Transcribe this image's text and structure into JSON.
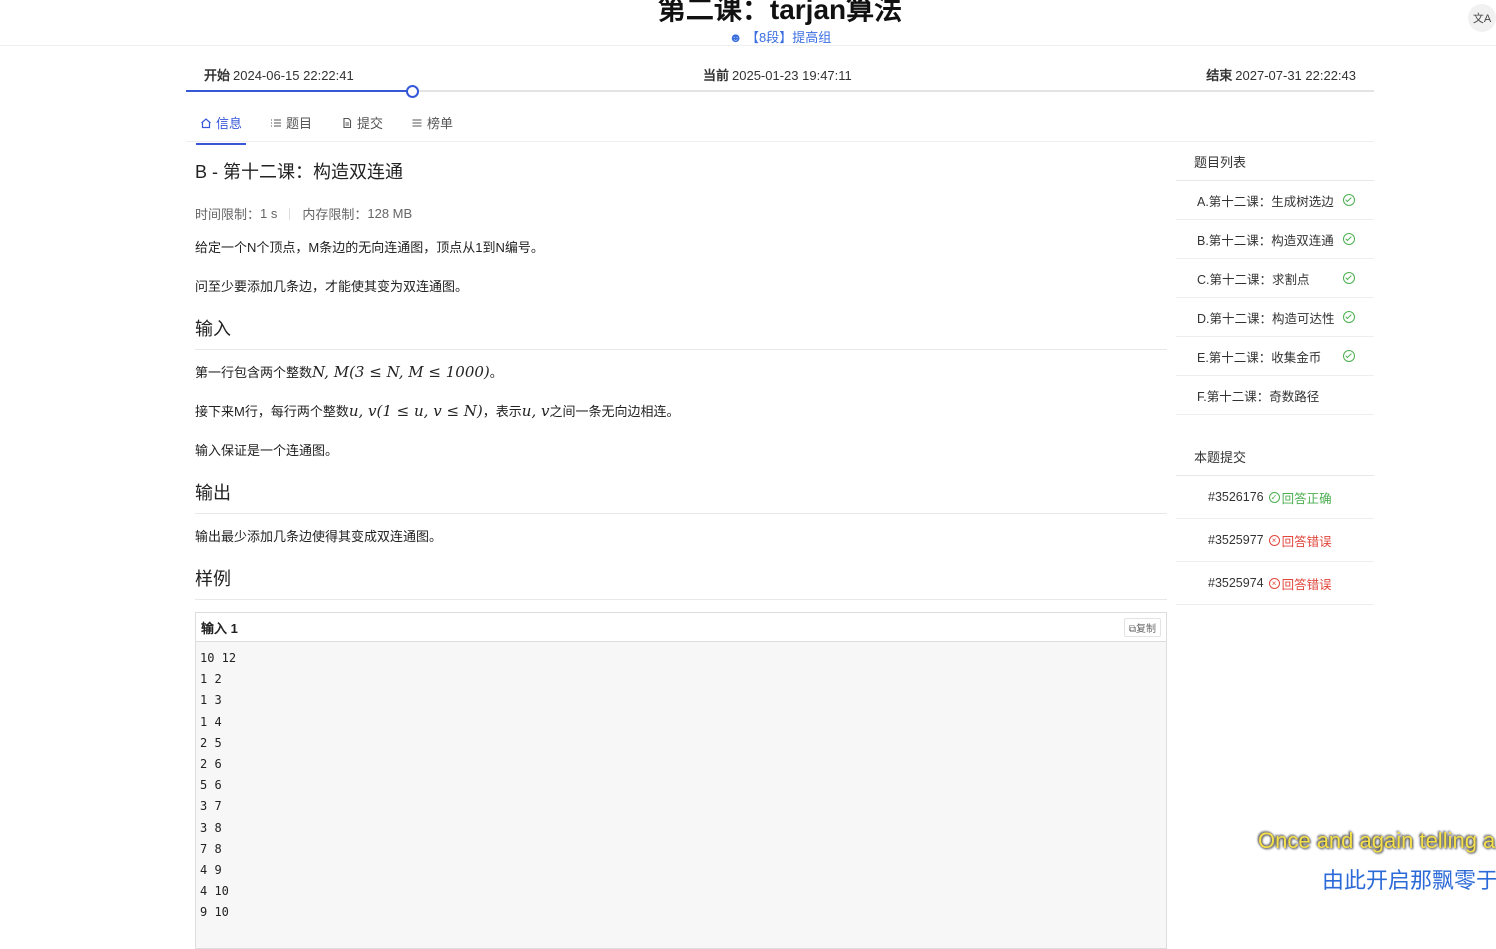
{
  "header": {
    "title": "第二课：tarjan算法",
    "group": "【8段】提高组",
    "translate_icon": "translate-icon"
  },
  "timeline": {
    "start_label": "开始",
    "start_time": "2024-06-15 22:22:41",
    "current_label": "当前",
    "current_time": "2025-01-23 19:47:11",
    "end_label": "结束",
    "end_time": "2027-07-31 22:22:43",
    "progress_fraction": 0.19
  },
  "tabs": [
    {
      "label": "信息",
      "icon": "home-icon",
      "active": true
    },
    {
      "label": "题目",
      "icon": "list-ordered-icon",
      "active": false
    },
    {
      "label": "提交",
      "icon": "file-icon",
      "active": false
    },
    {
      "label": "榜单",
      "icon": "list-icon",
      "active": false
    }
  ],
  "problem": {
    "title": "B - 第十二课：构造双连通",
    "time_limit_label": "时间限制：",
    "time_limit": "1 s",
    "memory_limit_label": "内存限制：",
    "memory_limit": "128 MB",
    "desc1": "给定一个N个顶点，M条边的无向连通图，顶点从1到N编号。",
    "desc2": "问至少要添加几条边，才能使其变为双连通图。",
    "input_heading": "输入",
    "input1_pre": "第一行包含两个整数",
    "input1_math": "N, M(3 ≤ N, M ≤ 1000)",
    "input1_post": "。",
    "input2_pre": "接下来M行，每行两个整数",
    "input2_math": "u, v(1 ≤ u, v ≤ N)",
    "input2_mid": "，表示",
    "input2_math2": "u, v",
    "input2_post": "之间一条无向边相连。",
    "input3": "输入保证是一个连通图。",
    "output_heading": "输出",
    "output1": "输出最少添加几条边使得其变成双连通图。",
    "sample_heading": "样例",
    "sample_title": "输入 1",
    "copy_label": "复制",
    "sample_lines": [
      "10 12",
      "1 2",
      "1 3",
      "1 4",
      "2 5",
      "2 6",
      "5 6",
      "3 7",
      "3 8",
      "7 8",
      "4 9",
      "4 10",
      "9 10"
    ]
  },
  "sidebar": {
    "list_heading": "题目列表",
    "problems": [
      {
        "label": "A.第十二课：生成树选边",
        "solved": true
      },
      {
        "label": "B.第十二课：构造双连通",
        "solved": true
      },
      {
        "label": "C.第十二课：求割点",
        "solved": true
      },
      {
        "label": "D.第十二课：构造可达性",
        "solved": true
      },
      {
        "label": "E.第十二课：收集金币",
        "solved": true
      },
      {
        "label": "F.第十二课：奇数路径",
        "solved": false
      }
    ],
    "submissions_heading": "本题提交",
    "submissions": [
      {
        "id": "#3526176",
        "status": "回答正确",
        "ok": true
      },
      {
        "id": "#3525977",
        "status": "回答错误",
        "ok": false
      },
      {
        "id": "#3525974",
        "status": "回答错误",
        "ok": false
      }
    ]
  },
  "overlay": {
    "line1": "Once and again telling a",
    "line2": "由此开启那飘零于"
  }
}
